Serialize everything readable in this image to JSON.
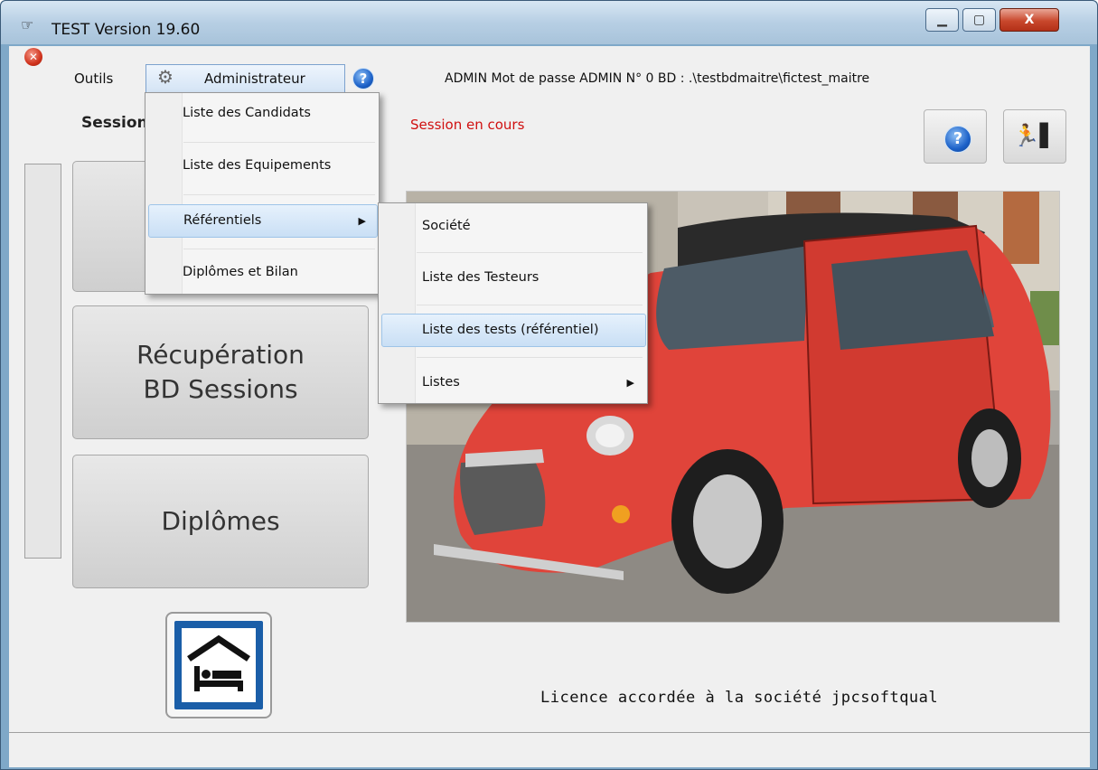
{
  "window": {
    "title": "TEST Version 19.60",
    "buttons": {
      "minimize": "▁",
      "maximize": "▢",
      "close": "X"
    }
  },
  "menubar": {
    "outils": "Outils",
    "administrateur": "Administrateur",
    "help": "?",
    "info": "ADMIN Mot de passe ADMIN N° 0  BD : .\\testbdmaitre\\fictest_maitre"
  },
  "session": {
    "label": "Session",
    "status": "Session en cours"
  },
  "toolbar": {
    "help": "?",
    "exit": "🏃▌"
  },
  "buttons": {
    "recuperation_line1": "Récupération",
    "recuperation_line2": "BD Sessions",
    "diplomes": "Diplômes"
  },
  "licence": "Licence accordée à la société  jpcsoftqual",
  "admin_menu": {
    "items": [
      "Liste des Candidats",
      "Liste des Equipements",
      "Référentiels",
      "Diplômes et Bilan"
    ],
    "highlighted_index": 2
  },
  "referentiels_menu": {
    "items": [
      "Société",
      "Liste des Testeurs",
      "Liste des tests (référentiel)",
      "Listes"
    ],
    "highlighted_index": 2
  },
  "colors": {
    "accent": "#1d62c9",
    "status_red": "#d01010",
    "car_red": "#e0443a",
    "home_blue": "#1a5ea8"
  },
  "icons": [
    "app-icon",
    "stop-icon",
    "gear-icon",
    "help-icon",
    "exit-icon",
    "home-bed-icon"
  ]
}
